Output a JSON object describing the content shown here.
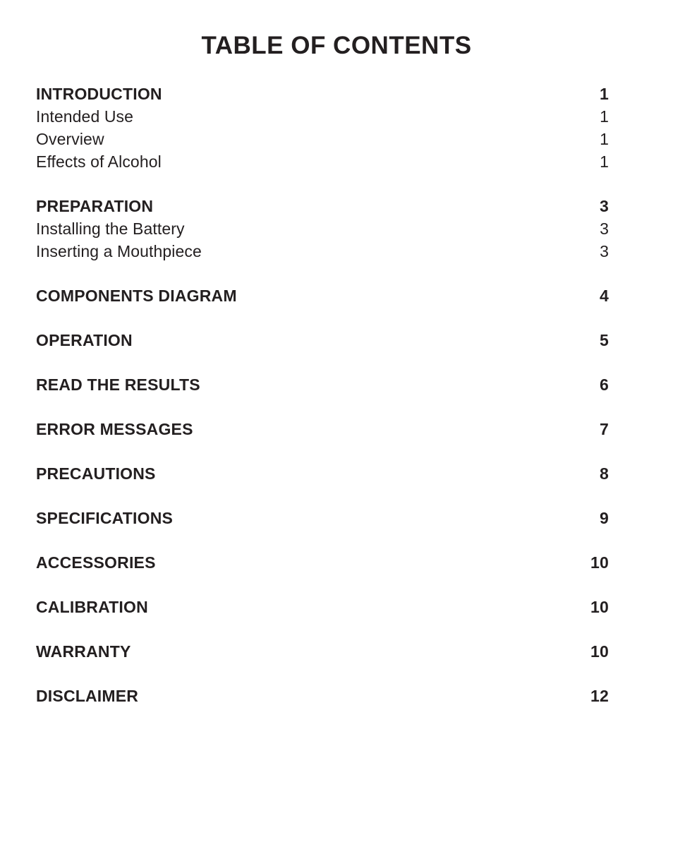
{
  "document": {
    "title": "TABLE OF CONTENTS",
    "text_color": "#231f20",
    "background_color": "#ffffff"
  },
  "toc": {
    "groups": [
      {
        "entries": [
          {
            "label": "INTRODUCTION",
            "page": "1",
            "level": "section"
          },
          {
            "label": "Intended Use",
            "page": "1",
            "level": "sub"
          },
          {
            "label": "Overview",
            "page": "1",
            "level": "sub"
          },
          {
            "label": "Effects of Alcohol",
            "page": "1",
            "level": "sub"
          }
        ]
      },
      {
        "entries": [
          {
            "label": "PREPARATION",
            "page": "3",
            "level": "section"
          },
          {
            "label": "Installing the Battery",
            "page": "3",
            "level": "sub"
          },
          {
            "label": "Inserting a Mouthpiece",
            "page": "3",
            "level": "sub"
          }
        ]
      },
      {
        "entries": [
          {
            "label": "COMPONENTS DIAGRAM",
            "page": "4",
            "level": "section"
          }
        ]
      },
      {
        "entries": [
          {
            "label": "OPERATION",
            "page": "5",
            "level": "section"
          }
        ]
      },
      {
        "entries": [
          {
            "label": "READ THE RESULTS",
            "page": "6",
            "level": "section"
          }
        ]
      },
      {
        "entries": [
          {
            "label": "ERROR MESSAGES",
            "page": "7",
            "level": "section"
          }
        ]
      },
      {
        "entries": [
          {
            "label": "PRECAUTIONS",
            "page": "8",
            "level": "section"
          }
        ]
      },
      {
        "entries": [
          {
            "label": "SPECIFICATIONS",
            "page": "9",
            "level": "section"
          }
        ]
      },
      {
        "entries": [
          {
            "label": "ACCESSORIES",
            "page": "10",
            "level": "section"
          }
        ]
      },
      {
        "entries": [
          {
            "label": "CALIBRATION",
            "page": "10",
            "level": "section"
          }
        ]
      },
      {
        "entries": [
          {
            "label": "WARRANTY",
            "page": "10",
            "level": "section"
          }
        ]
      },
      {
        "entries": [
          {
            "label": "DISCLAIMER",
            "page": "12",
            "level": "section"
          }
        ]
      }
    ]
  }
}
